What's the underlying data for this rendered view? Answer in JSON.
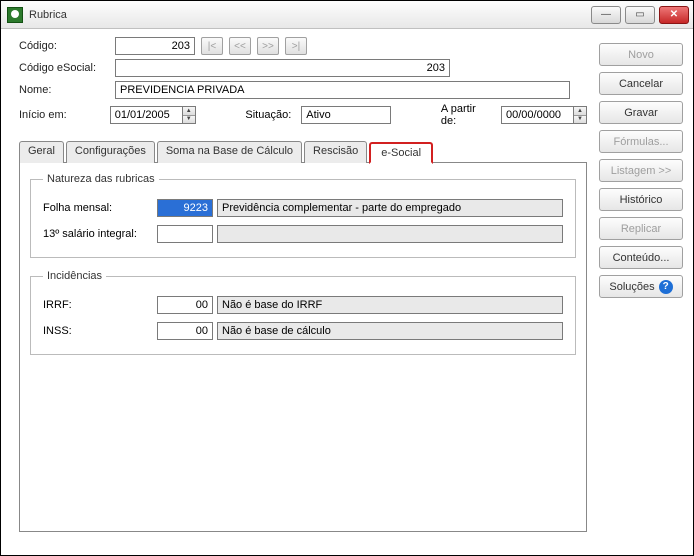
{
  "window": {
    "title": "Rubrica"
  },
  "header": {
    "codigo_label": "Código:",
    "codigo_value": "203",
    "codigo_esocial_label": "Código eSocial:",
    "codigo_esocial_value": "203",
    "nome_label": "Nome:",
    "nome_value": "PREVIDENCIA PRIVADA",
    "inicio_label": "Início em:",
    "inicio_value": "01/01/2005",
    "situacao_label": "Situação:",
    "situacao_value": "Ativo",
    "apartir_label": "A partir de:",
    "apartir_value": "00/00/0000"
  },
  "nav": {
    "first": "|<",
    "prev": "<<",
    "next": ">>",
    "last": ">|"
  },
  "tabs": {
    "geral": "Geral",
    "config": "Configurações",
    "soma": "Soma na Base de Cálculo",
    "rescisao": "Rescisão",
    "esocial": "e-Social"
  },
  "natureza": {
    "legend": "Natureza das rubricas",
    "folha_label": "Folha mensal:",
    "folha_code": "9223",
    "folha_desc": "Previdência complementar - parte do empregado",
    "decimo_label": "13º salário integral:",
    "decimo_code": "",
    "decimo_desc": ""
  },
  "incid": {
    "legend": "Incidências",
    "irrf_label": "IRRF:",
    "irrf_code": "00",
    "irrf_desc": "Não é base do IRRF",
    "inss_label": "INSS:",
    "inss_code": "00",
    "inss_desc": "Não é base de cálculo"
  },
  "side": {
    "novo": "Novo",
    "cancelar": "Cancelar",
    "gravar": "Gravar",
    "formulas": "Fórmulas...",
    "listagem": "Listagem >>",
    "historico": "Histórico",
    "replicar": "Replicar",
    "conteudo": "Conteúdo...",
    "solucoes": "Soluções"
  }
}
